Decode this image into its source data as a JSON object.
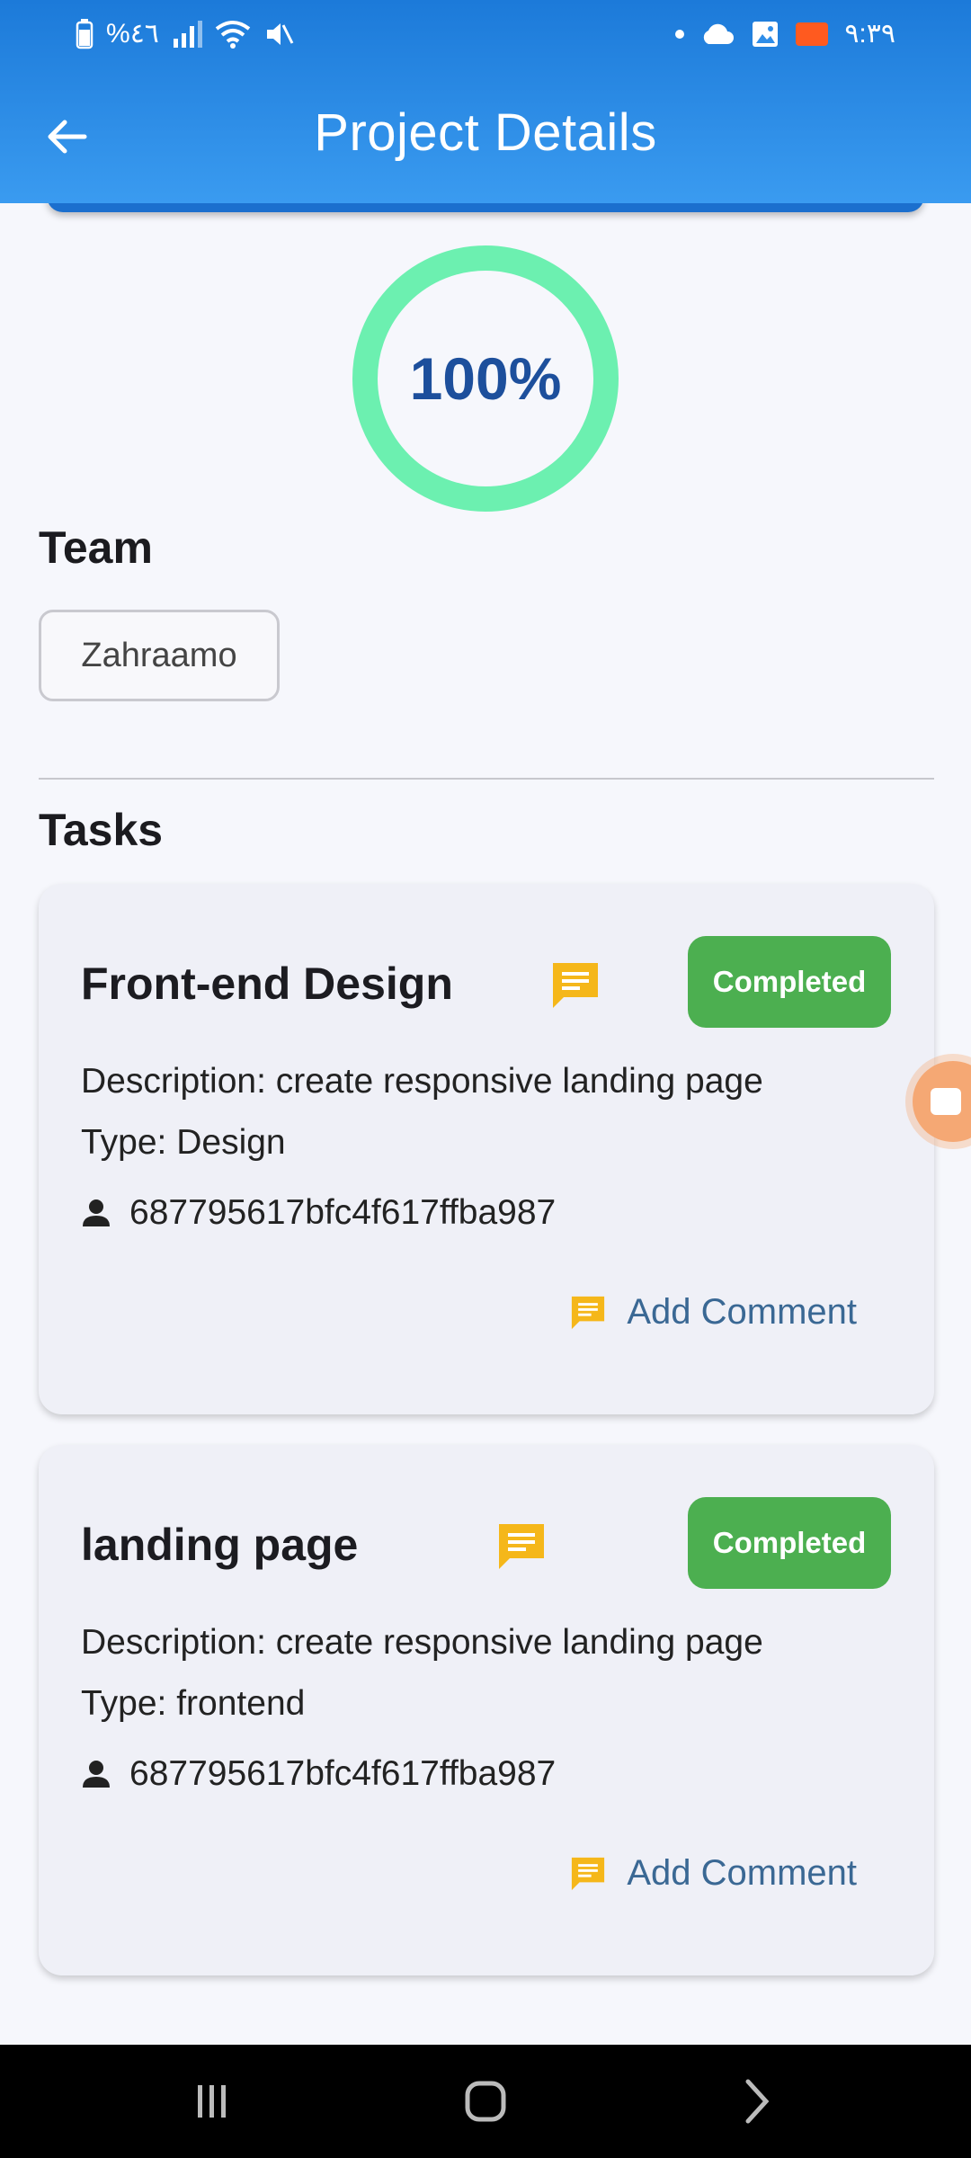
{
  "status_bar": {
    "left_text": "%٤٦",
    "time": "٩:٣٩"
  },
  "header": {
    "title": "Project Details",
    "back_icon": "arrow-left-icon"
  },
  "progress": {
    "label": "100%",
    "value": 1.0,
    "color": "#6cf0b0"
  },
  "team": {
    "title": "Team",
    "members": [
      "Zahraamo"
    ]
  },
  "tasks": {
    "title": "Tasks",
    "items": [
      {
        "title": "Front-end Design",
        "status": "Completed",
        "description": "Description: create responsive landing page",
        "type": "Type: Design",
        "assignee": "687795617bfc4f617ffba987",
        "add_comment": "Add Comment"
      },
      {
        "title": "landing page",
        "status": "Completed",
        "description": "Description: create responsive landing page",
        "type": "Type: frontend",
        "assignee": "687795617bfc4f617ffba987",
        "add_comment": "Add Comment"
      }
    ]
  },
  "colors": {
    "header": "#2f8de8",
    "status_completed": "#4caf50",
    "comment_icon": "#f5b71a",
    "link": "#3a6894"
  }
}
